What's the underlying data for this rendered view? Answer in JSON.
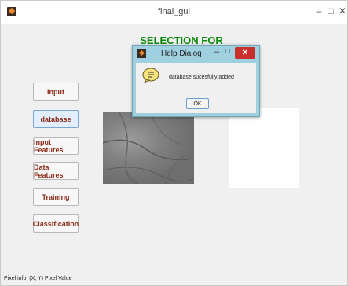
{
  "window": {
    "title": "final_gui",
    "min": "–",
    "max": "□",
    "close": "✕"
  },
  "heading": "SELECTION FOR SPORTS",
  "sidebar": {
    "items": [
      {
        "label": "Input"
      },
      {
        "label": "database"
      },
      {
        "label": "Input Features"
      },
      {
        "label": "Data Features"
      },
      {
        "label": "Training"
      },
      {
        "label": "Classification"
      }
    ]
  },
  "status": {
    "pixel_info": "Pixel info: (X, Y)  Pixel Value"
  },
  "dialog": {
    "title": "Help Dialog",
    "min": "–",
    "max": "□",
    "close": "✕",
    "message": "database sucesfully added",
    "ok_label": "OK"
  },
  "colors": {
    "heading": "#0a8a0a",
    "button_text": "#8a2a16",
    "dialog_frame": "#9fd0df",
    "close_button": "#c9302c"
  }
}
